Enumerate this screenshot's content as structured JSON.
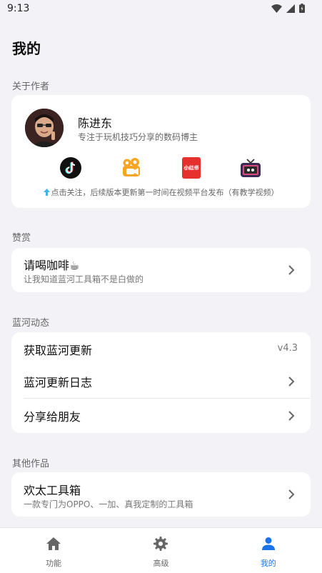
{
  "status_bar": {
    "time": "9:13"
  },
  "page": {
    "title": "我的"
  },
  "sections": {
    "author": "关于作者",
    "reward": "赞赏",
    "news": "蓝河动态",
    "other": "其他作品"
  },
  "author": {
    "name": "陈进东",
    "description": "专注于玩机技巧分享的数码博主",
    "platforms": [
      {
        "icon": "tiktok-icon"
      },
      {
        "icon": "kuaishou-icon"
      },
      {
        "icon": "xiaohongshu-icon",
        "label": "小红书"
      },
      {
        "icon": "tv-icon"
      }
    ],
    "follow_hint": "点击关注，后续版本更新第一时间在视频平台发布（有教学视频）"
  },
  "reward": {
    "title": "请喝咖啡☕",
    "subtitle": "让我知道蓝河工具箱不是白做的"
  },
  "news": {
    "update": {
      "title": "获取蓝河更新",
      "version": "v4.3"
    },
    "changelog": {
      "title": "蓝河更新日志"
    },
    "share": {
      "title": "分享给朋友"
    }
  },
  "other": {
    "toolbox": {
      "title": "欢太工具箱",
      "subtitle": "一款专门为OPPO、一加、真我定制的工具箱"
    }
  },
  "bottom_nav": {
    "items": [
      {
        "label": "功能",
        "icon": "home-icon"
      },
      {
        "label": "高级",
        "icon": "gear-icon"
      },
      {
        "label": "我的",
        "icon": "person-icon",
        "active": true
      }
    ]
  },
  "colors": {
    "accent": "#1a73e8",
    "background": "#f2f2f7"
  }
}
